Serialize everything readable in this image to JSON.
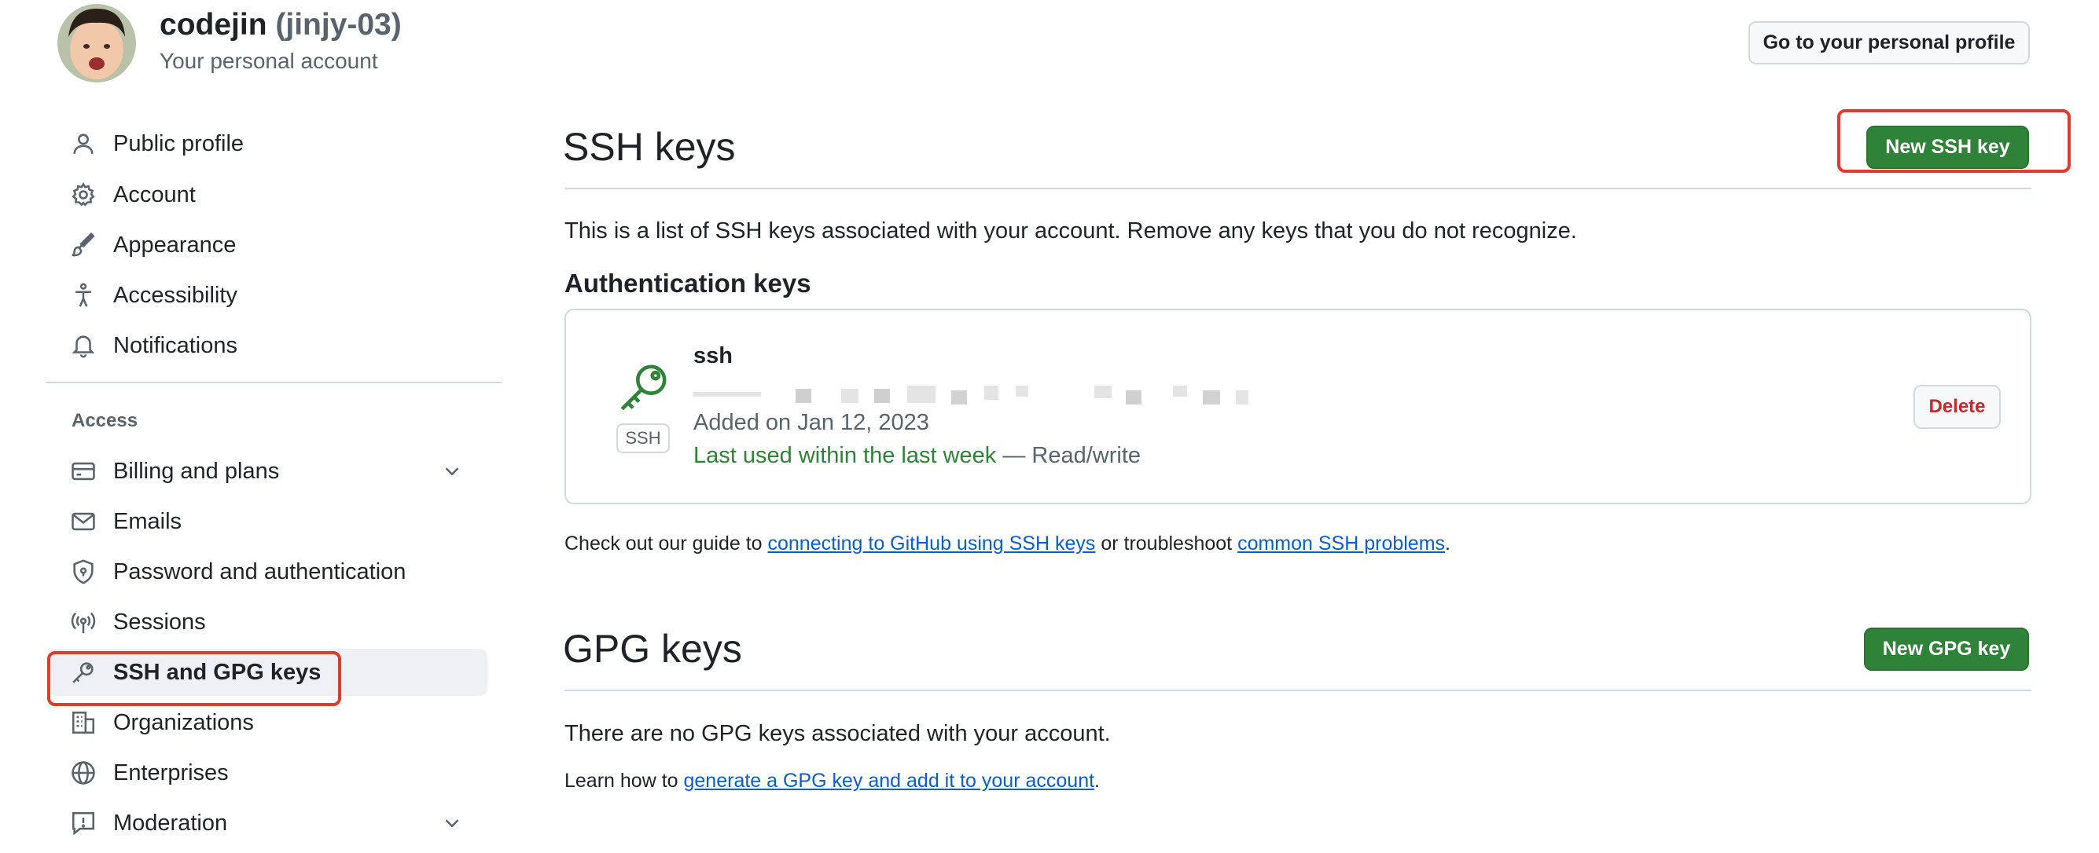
{
  "header": {
    "username": "codejin",
    "handle": "(jinjy-03)",
    "subtitle": "Your personal account",
    "profile_button": "Go to your personal profile"
  },
  "sidebar": {
    "items": [
      {
        "label": "Public profile",
        "icon": "person-icon"
      },
      {
        "label": "Account",
        "icon": "gear-icon"
      },
      {
        "label": "Appearance",
        "icon": "paintbrush-icon"
      },
      {
        "label": "Accessibility",
        "icon": "accessibility-icon"
      },
      {
        "label": "Notifications",
        "icon": "bell-icon"
      }
    ],
    "access_label": "Access",
    "access_items": [
      {
        "label": "Billing and plans",
        "icon": "credit-card-icon",
        "expandable": true
      },
      {
        "label": "Emails",
        "icon": "mail-icon"
      },
      {
        "label": "Password and authentication",
        "icon": "shield-lock-icon"
      },
      {
        "label": "Sessions",
        "icon": "broadcast-icon"
      },
      {
        "label": "SSH and GPG keys",
        "icon": "key-icon",
        "selected": true
      },
      {
        "label": "Organizations",
        "icon": "organization-icon"
      },
      {
        "label": "Enterprises",
        "icon": "globe-icon"
      },
      {
        "label": "Moderation",
        "icon": "report-icon",
        "expandable": true
      }
    ]
  },
  "ssh": {
    "title": "SSH keys",
    "new_button": "New SSH key",
    "description": "This is a list of SSH keys associated with your account. Remove any keys that you do not recognize.",
    "auth_heading": "Authentication keys",
    "key": {
      "name": "ssh",
      "type_tag": "SSH",
      "added": "Added on Jan 12, 2023",
      "last_used": "Last used within the last week",
      "access": "— Read/write",
      "delete_label": "Delete"
    },
    "guide_prefix": "Check out our guide to ",
    "guide_link1": "connecting to GitHub using SSH keys",
    "guide_mid": " or troubleshoot ",
    "guide_link2": "common SSH problems",
    "guide_suffix": "."
  },
  "gpg": {
    "title": "GPG keys",
    "new_button": "New GPG key",
    "empty_text": "There are no GPG keys associated with your account.",
    "learn_prefix": "Learn how to ",
    "learn_link": "generate a GPG key and add it to your account",
    "learn_suffix": "."
  },
  "colors": {
    "primary_green": "#2f8339",
    "link_blue": "#0a5ecc",
    "danger_red": "#c62a2f",
    "annotation_red": "#e03c2c"
  }
}
